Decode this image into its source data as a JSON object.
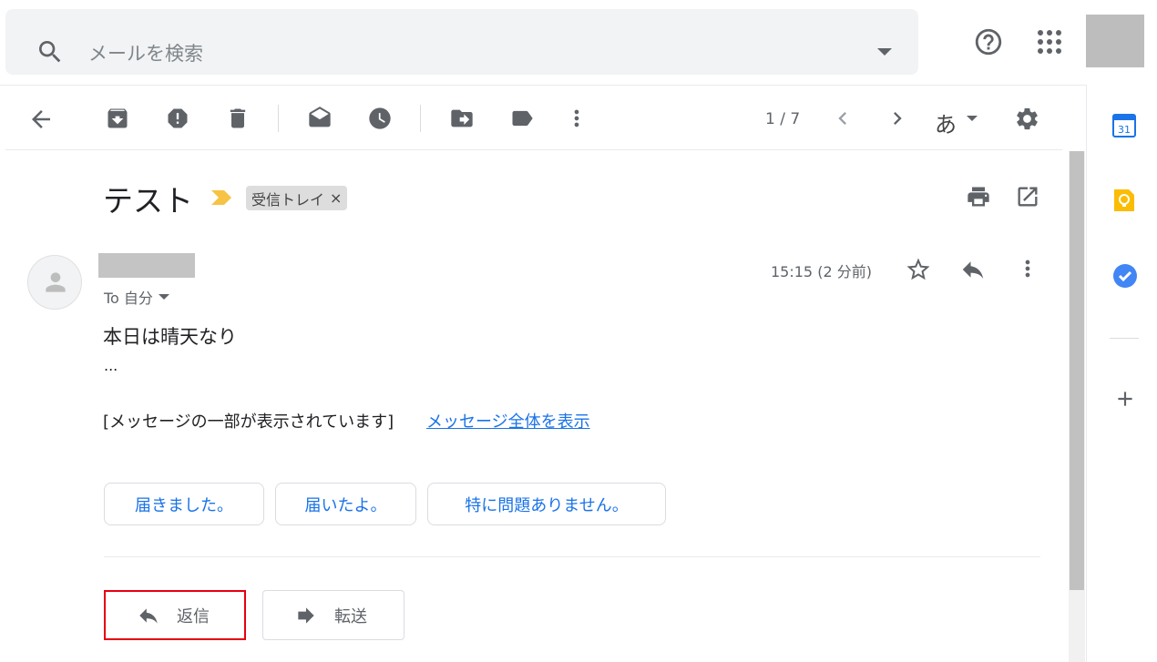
{
  "search": {
    "placeholder": "メールを検索"
  },
  "toolbar": {
    "page_count": "1 / 7",
    "input_tool": "あ"
  },
  "email": {
    "subject": "テスト",
    "label": "受信トレイ",
    "label_remove": "×",
    "to": "To 自分",
    "timestamp": "15:15 (2 分前)",
    "body": "本日は晴天なり",
    "ellipsis": "...",
    "clipped_notice": "[メッセージの一部が表示されています]",
    "view_full_link": "メッセージ全体を表示"
  },
  "smart_replies": [
    "届きました。",
    "届いたよ。",
    "特に問題ありません。"
  ],
  "actions": {
    "reply": "返信",
    "forward": "転送"
  },
  "side_panel": {
    "calendar_day": "31"
  },
  "colors": {
    "accent": "#1a73e8",
    "highlight_box": "#e60012",
    "important_marker": "#f6c344"
  },
  "icons": [
    "search-icon",
    "help-icon",
    "apps-icon",
    "back-icon",
    "archive-icon",
    "report-spam-icon",
    "delete-icon",
    "mark-unread-icon",
    "snooze-icon",
    "move-to-icon",
    "label-icon",
    "more-icon",
    "prev-icon",
    "next-icon",
    "settings-icon",
    "print-icon",
    "open-new-window-icon",
    "star-icon",
    "reply-icon",
    "forward-icon",
    "calendar-icon",
    "keep-icon",
    "tasks-icon",
    "add-icon"
  ]
}
